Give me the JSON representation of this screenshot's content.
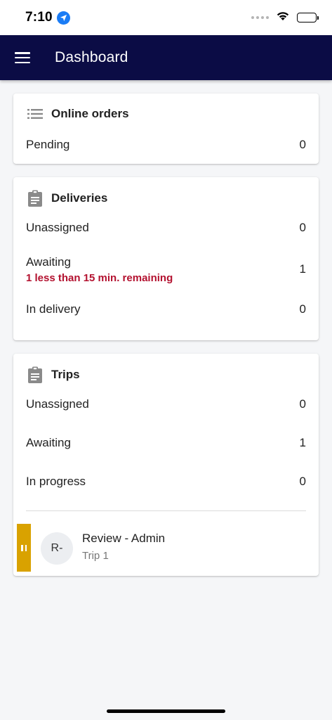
{
  "status_bar": {
    "time": "7:10",
    "icons": [
      "location-arrow-icon",
      "signal-icon",
      "wifi-icon",
      "battery-icon"
    ]
  },
  "app_bar": {
    "title": "Dashboard",
    "background": "#0b0c45",
    "menu_icon": "hamburger-menu-icon"
  },
  "online_orders": {
    "title": "Online orders",
    "icon": "list-icon",
    "rows": [
      {
        "label": "Pending",
        "count": "0"
      }
    ]
  },
  "deliveries": {
    "title": "Deliveries",
    "icon": "clipboard-icon",
    "rows": [
      {
        "label": "Unassigned",
        "count": "0"
      },
      {
        "label": "Awaiting",
        "count": "1",
        "warning": "1 less than 15 min. remaining"
      },
      {
        "label": "In delivery",
        "count": "0"
      }
    ]
  },
  "trips": {
    "title": "Trips",
    "icon": "clipboard-icon",
    "rows": [
      {
        "label": "Unassigned",
        "count": "0"
      },
      {
        "label": "Awaiting",
        "count": "1"
      },
      {
        "label": "In progress",
        "count": "0"
      }
    ],
    "items": [
      {
        "avatar": "R-",
        "name": "Review - Admin",
        "subtitle": "Trip 1",
        "status_color": "#d9a200",
        "status_icon": "pause-icon"
      }
    ]
  },
  "colors": {
    "warning_text": "#b3112f",
    "page_background": "#f5f6f8"
  }
}
